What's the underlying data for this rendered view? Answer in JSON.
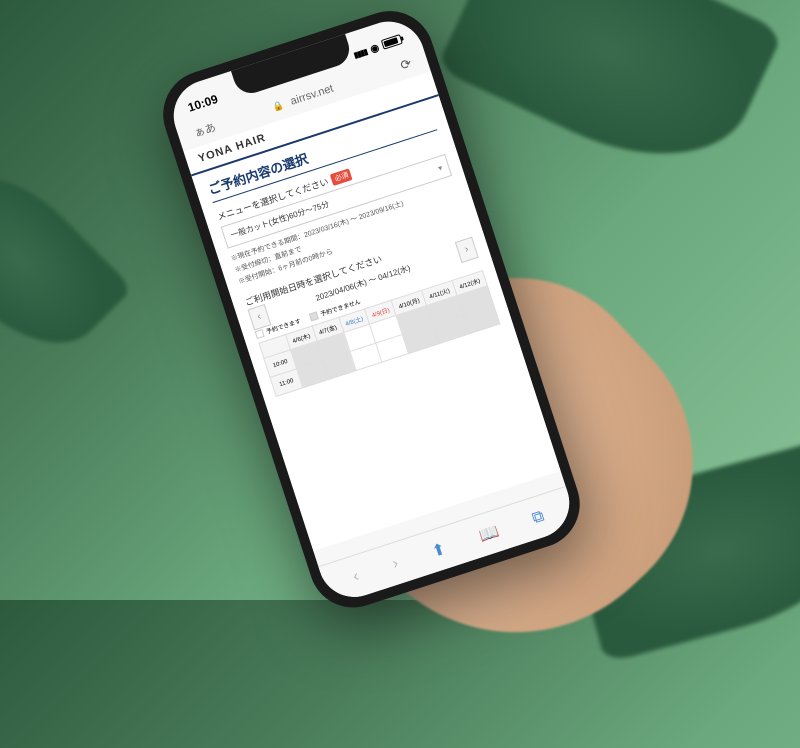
{
  "status": {
    "time": "10:09"
  },
  "browser": {
    "text_size": "ぁあ",
    "domain": "airrsv.net"
  },
  "site": {
    "name": "YONA HAIR"
  },
  "reservation": {
    "title": "ご予約内容の選択",
    "menu_label": "メニューを選択してください",
    "required": "必須",
    "selected_menu": "一般カット(女性)60分〜75分",
    "period_label": "※現在予約できる期間：2023/03/16(木) 〜 2023/09/16(土)",
    "deadline_label": "※受付締切：直前まで",
    "start_label": "※受付開始：6ヶ月前の0時から",
    "date_label": "ご利用開始日時を選択してください",
    "date_range": "2023/04/06(木) 〜 04/12(水)",
    "legend_available": "予約できます",
    "legend_unavailable": "予約できません",
    "days": [
      "4/6(木)",
      "4/7(金)",
      "4/8(土)",
      "4/9(日)",
      "4/10(月)",
      "4/11(火)",
      "4/12(水)"
    ],
    "times": [
      "10:00",
      "11:00"
    ]
  }
}
